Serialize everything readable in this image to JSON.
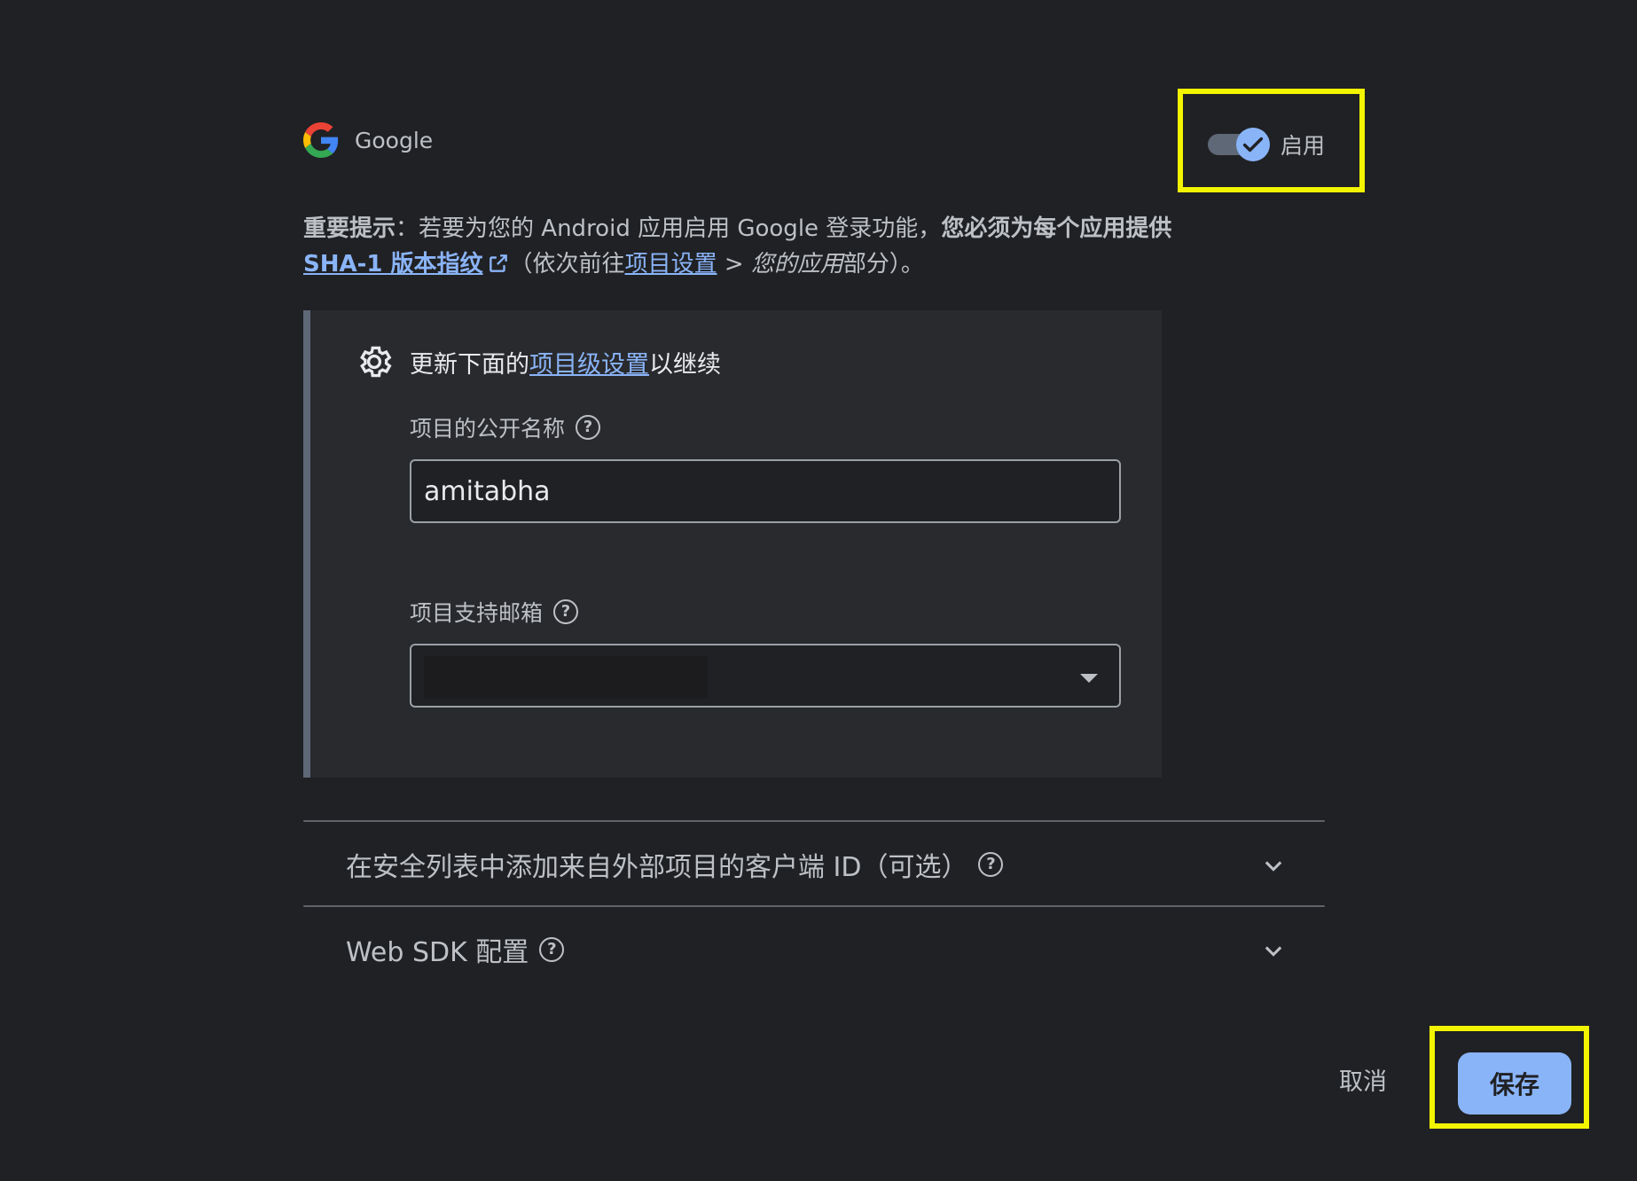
{
  "provider": {
    "name": "Google"
  },
  "toggle": {
    "label": "启用",
    "state": "on"
  },
  "notice": {
    "important_label": "重要提示",
    "colon": "：",
    "text1": "若要为您的 Android 应用启用 Google 登录功能，",
    "bold_text": "您必须为每个应用提供",
    "sha_link": "SHA-1 版本指纹",
    "text2": "（依次前往",
    "project_settings_link": "项目设置",
    "text3": " > ",
    "your_apps": "您的应用",
    "text4": "部分）。"
  },
  "settings": {
    "heading_prefix": "更新下面的",
    "heading_link": "项目级设置",
    "heading_suffix": "以继续",
    "public_name_label": "项目的公开名称",
    "public_name_value": "amitabha",
    "support_email_label": "项目支持邮箱"
  },
  "accordions": [
    {
      "title": "在安全列表中添加来自外部项目的客户端 ID（可选）"
    },
    {
      "title": "Web SDK 配置"
    }
  ],
  "footer": {
    "cancel_label": "取消",
    "save_label": "保存"
  },
  "colors": {
    "accent": "#8ab4f8",
    "background": "#202124",
    "highlight": "#f3f500"
  }
}
